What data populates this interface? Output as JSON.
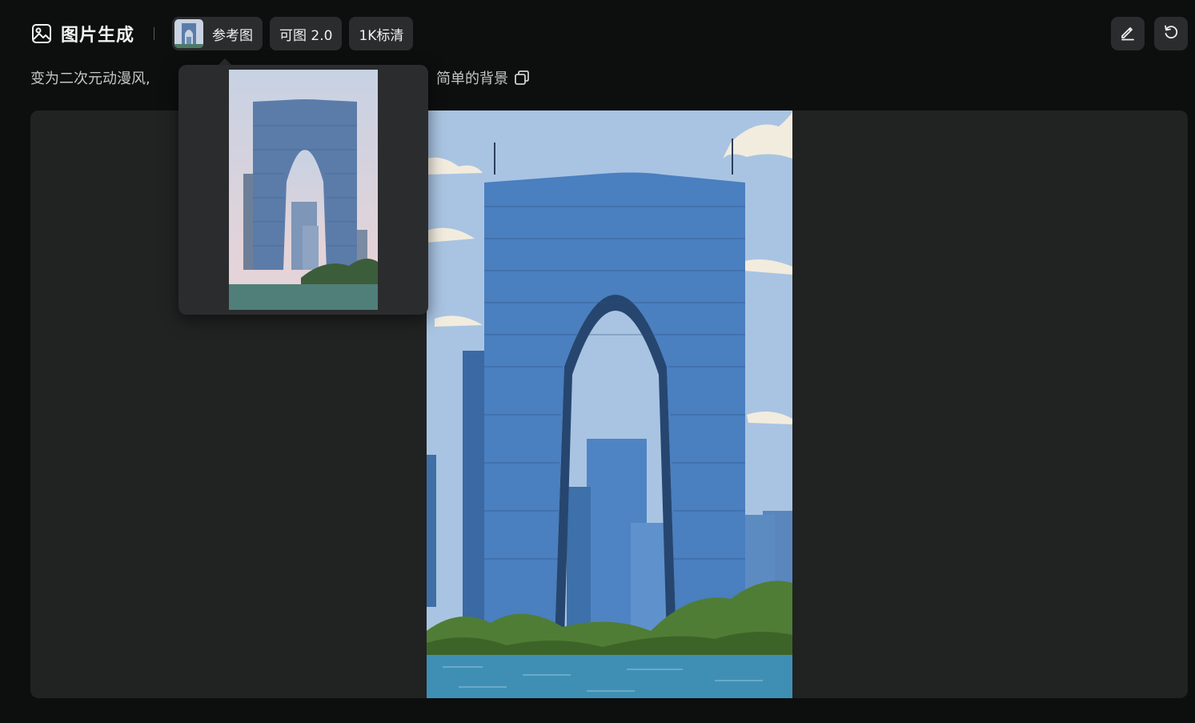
{
  "header": {
    "title": "图片生成",
    "icon": "image-icon",
    "chips": {
      "reference": "参考图",
      "model": "可图 2.0",
      "quality": "1K标清"
    },
    "actions": {
      "edit_icon": "pencil-icon",
      "regenerate_icon": "refresh-icon"
    }
  },
  "prompt": {
    "visible_start": "变为二次元动漫风,",
    "visible_end": "简单的背景",
    "copy_icon": "copy-icon"
  },
  "colors": {
    "background": "#0d0e0e",
    "panel": "#212222",
    "chip": "#2b2c2e",
    "sky": "#a9c4e2",
    "tower": "#4a7fc0",
    "water": "#3f8fb5",
    "trees": "#4f7d35"
  }
}
